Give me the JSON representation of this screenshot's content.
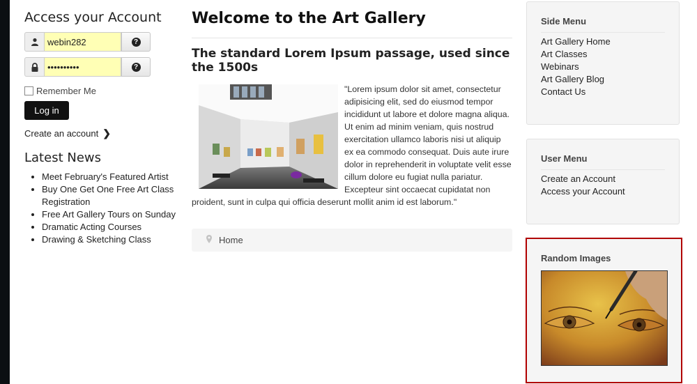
{
  "login": {
    "title": "Access your Account",
    "username_value": "webin282",
    "password_value": "••••••••••",
    "help_glyph": "?",
    "remember_label": "Remember Me",
    "login_button": "Log in",
    "create_account": "Create an account",
    "chevron": "❯"
  },
  "news": {
    "title": "Latest News",
    "items": [
      "Meet February's Featured Artist",
      "Buy One Get One Free Art Class Registration",
      "Free Art Gallery Tours on Sunday",
      "Dramatic Acting Courses",
      "Drawing & Sketching Class"
    ]
  },
  "main": {
    "page_title": "Welcome to the Art Gallery",
    "article_title": "The standard Lorem Ipsum passage, used since the 1500s",
    "article_text": "\"Lorem ipsum dolor sit amet, consectetur adipisicing elit, sed do eiusmod tempor incididunt ut labore et dolore magna aliqua. Ut enim ad minim veniam, quis nostrud exercitation ullamco laboris nisi ut aliquip ex ea commodo consequat. Duis aute irure dolor in reprehenderit in voluptate velit esse cillum dolore eu fugiat nulla pariatur. Excepteur sint occaecat cupidatat non proident, sunt in culpa qui officia deserunt mollit anim id est laborum.\"",
    "breadcrumb": "Home"
  },
  "side_menu": {
    "title": "Side Menu",
    "items": [
      "Art Gallery Home",
      "Art Classes",
      "Webinars",
      "Art Gallery Blog",
      "Contact Us"
    ]
  },
  "user_menu": {
    "title": "User Menu",
    "items": [
      "Create an Account",
      "Access your Account"
    ]
  },
  "random_images": {
    "title": "Random Images"
  },
  "icons": {
    "user": "user-icon",
    "lock": "lock-icon",
    "help": "help-icon",
    "chevron": "chevron-right-icon",
    "pin": "map-marker-icon"
  },
  "colors": {
    "background": "#0b0f12",
    "autofill": "#ffffb5",
    "highlight_border": "#b00000",
    "login_button": "#111111"
  }
}
